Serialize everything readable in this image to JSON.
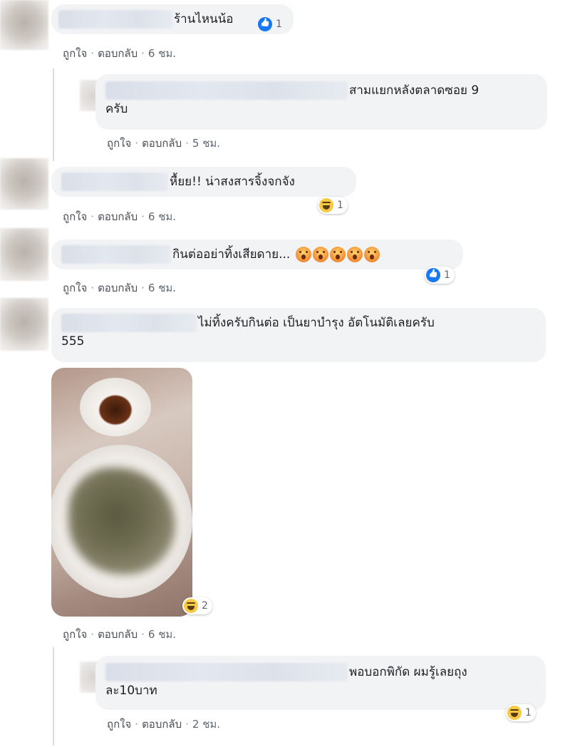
{
  "comments": [
    {
      "id": "c1",
      "text": "ร้านไหนน้อ",
      "reaction": {
        "type": "like",
        "count": "1"
      },
      "actions": {
        "like": "ถูกใจ",
        "reply": "ตอบกลับ",
        "time": "6 ชม."
      }
    },
    {
      "id": "c2",
      "text_line1": "สามแยกหลังตลาดซอย 9",
      "text_line2": "ครับ",
      "actions": {
        "like": "ถูกใจ",
        "reply": "ตอบกลับ",
        "time": "5 ชม."
      }
    },
    {
      "id": "c3",
      "text": "หื้ยย!! น่าสงสารจิ้งจกจัง",
      "reaction": {
        "type": "haha",
        "count": "1"
      },
      "actions": {
        "like": "ถูกใจ",
        "reply": "ตอบกลับ",
        "time": "6 ชม."
      }
    },
    {
      "id": "c4",
      "text": "กินต่ออย่าทิ้งเสียดาย...",
      "reaction": {
        "type": "like",
        "count": "1"
      },
      "actions": {
        "like": "ถูกใจ",
        "reply": "ตอบกลับ",
        "time": "6 ชม."
      }
    },
    {
      "id": "c5",
      "text_line1": "ไม่ทิ้งครับกินต่อ เป็นยาบำรุง อัตโนมัติเลยครับ",
      "text_line2": "555",
      "reaction": {
        "type": "haha",
        "count": "2"
      },
      "actions": {
        "like": "ถูกใจ",
        "reply": "ตอบกลับ",
        "time": "6 ชม."
      }
    },
    {
      "id": "c6",
      "text_line1": "พอบอกพิกัด ผมรู้เลยถุง",
      "text_line2": "ละ10บาท",
      "reaction": {
        "type": "haha",
        "count": "1"
      },
      "actions": {
        "like": "ถูกใจ",
        "reply": "ตอบกลับ",
        "time": "2 ชม."
      }
    }
  ],
  "separator": "·",
  "icons": {
    "like": "like-thumb-icon",
    "haha": "haha-emoji-icon",
    "wow": "wow-emoji-icon"
  },
  "colors": {
    "bubble": "#f2f3f5",
    "like_blue": "#1877f2",
    "meta_text": "#606770"
  }
}
